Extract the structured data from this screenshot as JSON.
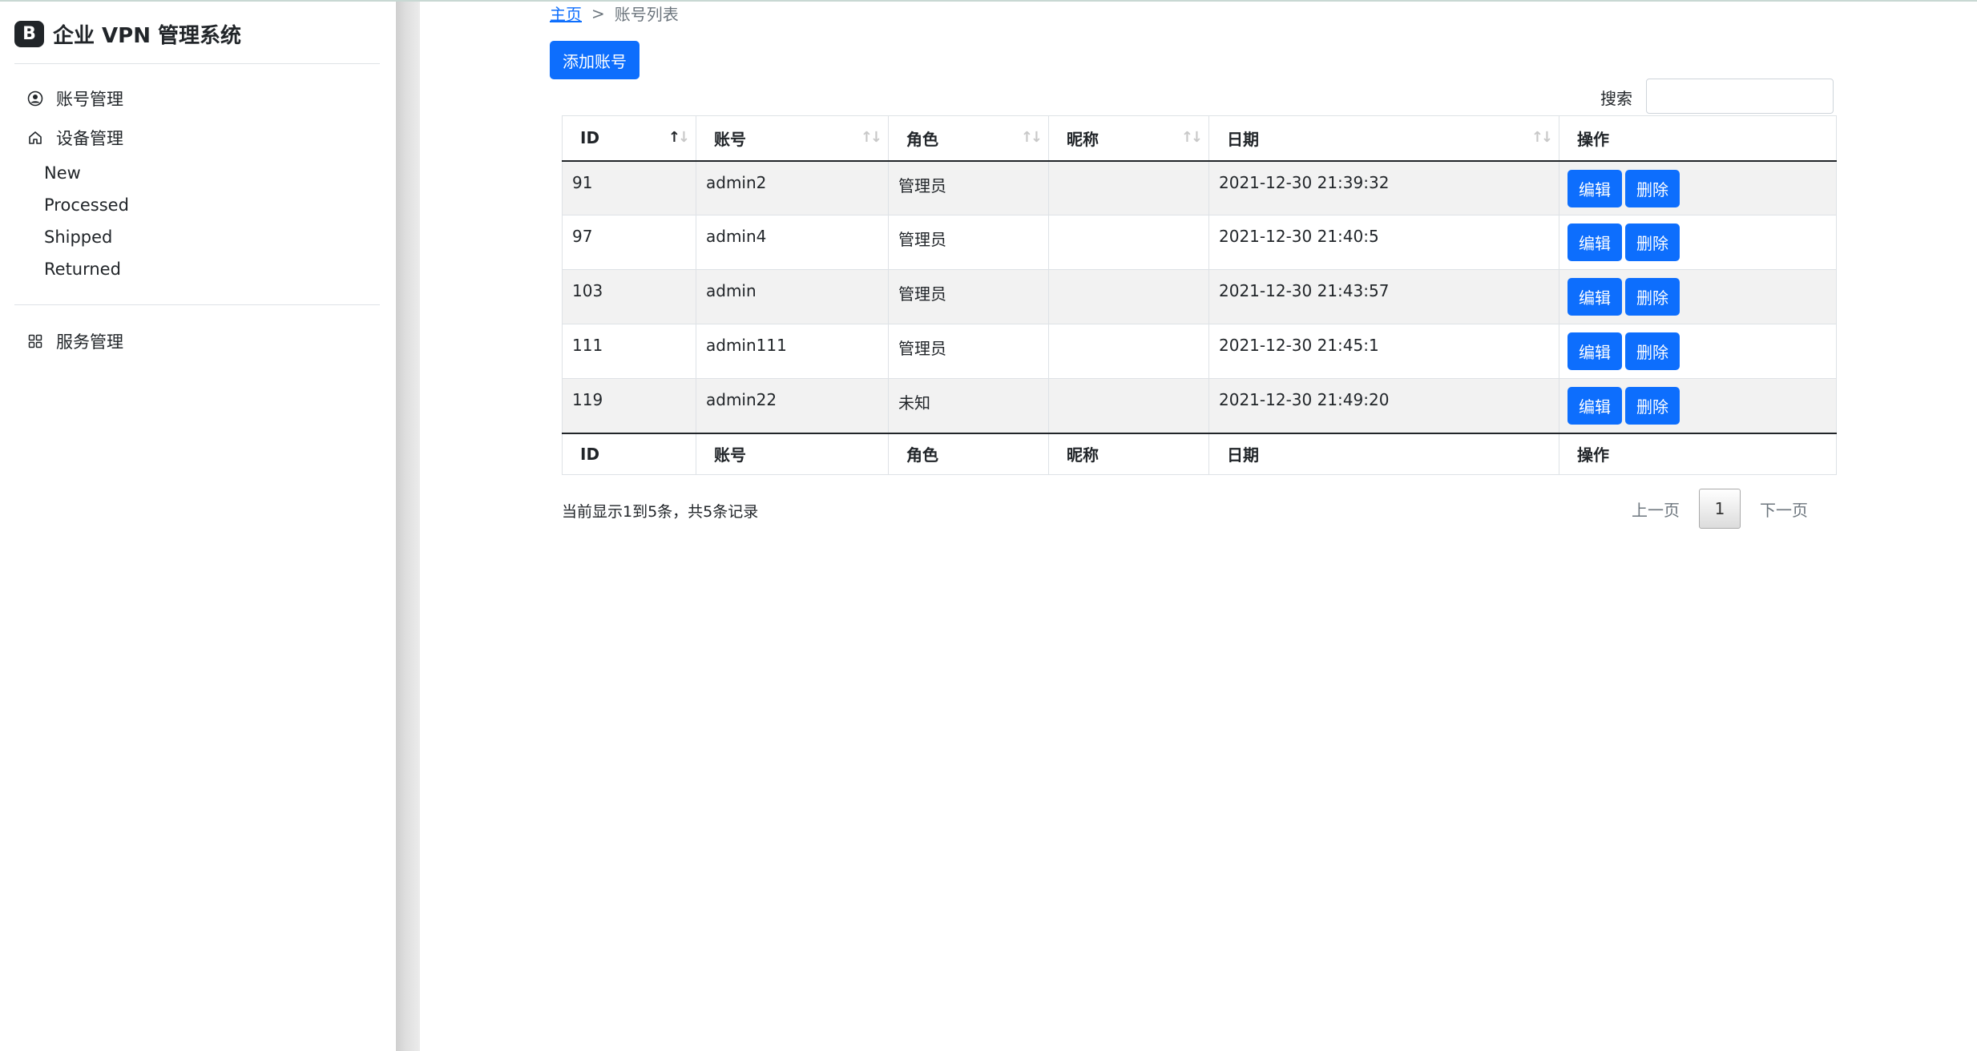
{
  "brand": {
    "logo_letter": "B",
    "title": "企业 VPN 管理系统"
  },
  "sidebar": {
    "items": [
      {
        "label": "账号管理",
        "icon": "person-circle-icon"
      },
      {
        "label": "设备管理",
        "icon": "house-icon"
      },
      {
        "label": "服务管理",
        "icon": "grid-icon"
      }
    ],
    "sub_items": [
      "New",
      "Processed",
      "Shipped",
      "Returned"
    ]
  },
  "breadcrumb": {
    "home": "主页",
    "separator": ">",
    "current": "账号列表"
  },
  "toolbar": {
    "add_label": "添加账号"
  },
  "search": {
    "label": "搜索",
    "value": ""
  },
  "table": {
    "columns": [
      "ID",
      "账号",
      "角色",
      "昵称",
      "日期",
      "操作"
    ],
    "sort_indicator": "↑↓",
    "rows": [
      {
        "id": "91",
        "account": "admin2",
        "role": "管理员",
        "nickname": "",
        "date": "2021-12-30 21:39:32"
      },
      {
        "id": "97",
        "account": "admin4",
        "role": "管理员",
        "nickname": "",
        "date": "2021-12-30 21:40:5"
      },
      {
        "id": "103",
        "account": "admin",
        "role": "管理员",
        "nickname": "",
        "date": "2021-12-30 21:43:57"
      },
      {
        "id": "111",
        "account": "admin111",
        "role": "管理员",
        "nickname": "",
        "date": "2021-12-30 21:45:1"
      },
      {
        "id": "119",
        "account": "admin22",
        "role": "未知",
        "nickname": "",
        "date": "2021-12-30 21:49:20"
      }
    ],
    "edit_label": "编辑",
    "delete_label": "删除"
  },
  "footer": {
    "info": "当前显示1到5条，共5条记录",
    "prev": "上一页",
    "current_page": "1",
    "next": "下一页"
  },
  "colors": {
    "primary": "#0d6efd",
    "stripe": "#f2f2f2",
    "text": "#212529"
  }
}
